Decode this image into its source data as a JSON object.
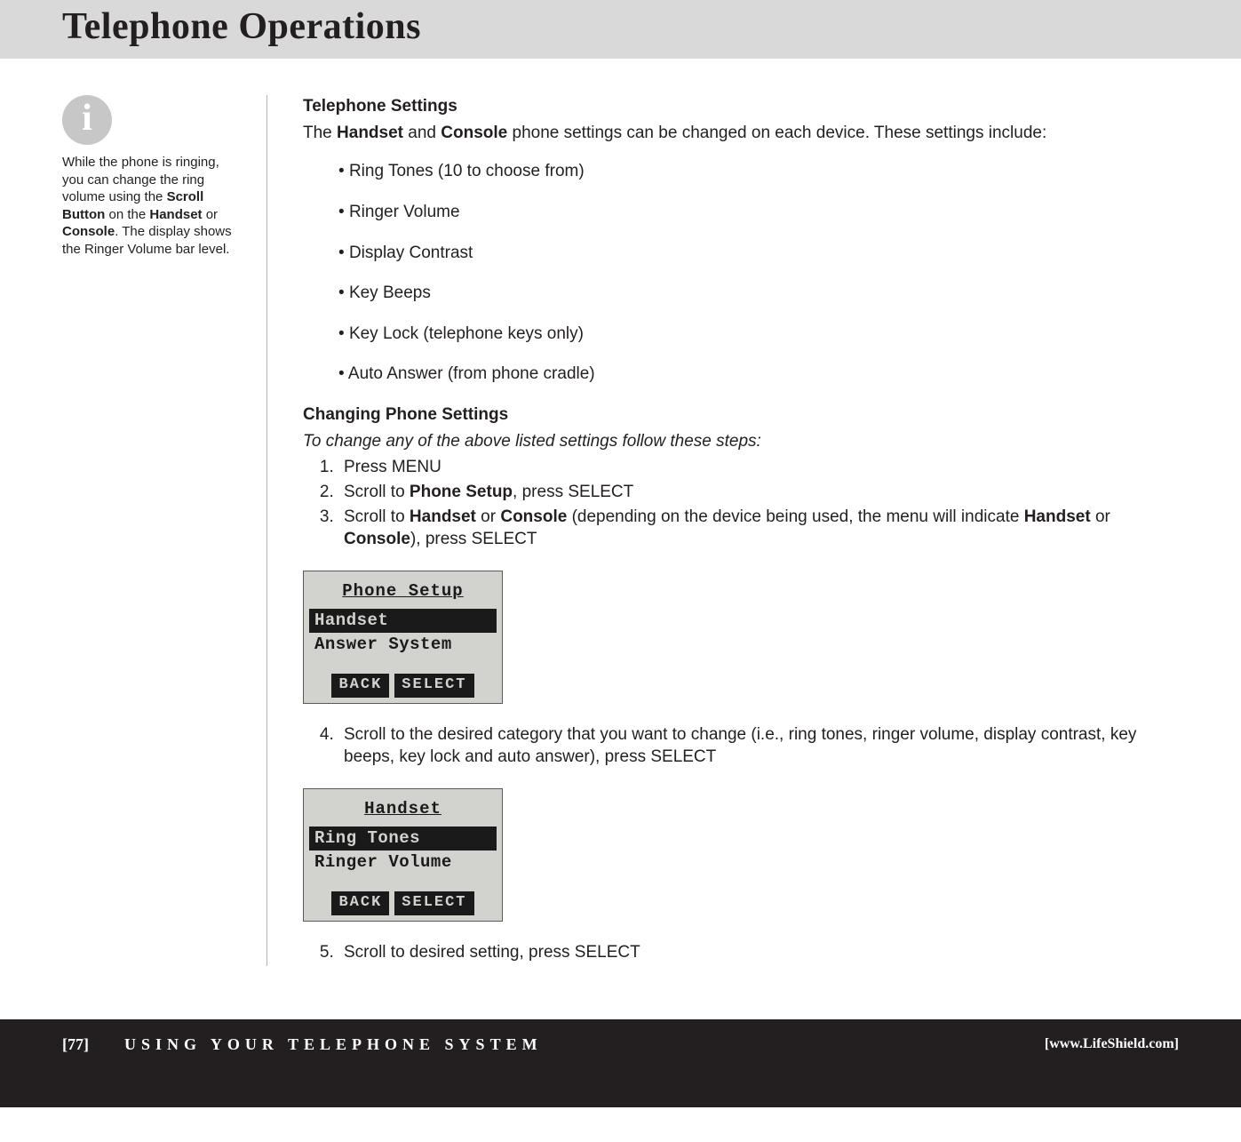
{
  "header": {
    "title": "Telephone Operations"
  },
  "sidebar": {
    "tip_parts": [
      "While the phone is ringing, you can change the ring volume using the ",
      "Scroll Button",
      " on the ",
      "Handset",
      " or ",
      "Console",
      ". The display shows the Ringer Volume bar level."
    ]
  },
  "main": {
    "settings_title": "Telephone Settings",
    "settings_intro_parts": [
      "The ",
      "Handset",
      " and ",
      "Console",
      " phone settings can be changed on each device. These settings include:"
    ],
    "bullets": [
      "Ring Tones (10 to choose from)",
      "Ringer Volume",
      "Display Contrast",
      "Key Beeps",
      "Key Lock (telephone keys only)",
      "Auto Answer (from phone cradle)"
    ],
    "changing_title": "Changing Phone Settings",
    "changing_lead": "To change any of the above listed settings follow these steps:",
    "steps_1_3": [
      {
        "plain": "Press MENU"
      },
      {
        "parts": [
          "Scroll to ",
          "Phone Setup",
          ", press SELECT"
        ]
      },
      {
        "parts": [
          "Scroll to ",
          "Handset",
          " or ",
          "Console",
          " (depending on the device being used, the menu will indicate ",
          "Handset",
          " or ",
          "Console",
          "), press SELECT"
        ]
      }
    ],
    "lcd1": {
      "title": "Phone Setup",
      "rows": [
        {
          "text": "Handset",
          "selected": true
        },
        {
          "text": "Answer System",
          "selected": false
        }
      ],
      "buttons": [
        "BACK",
        "SELECT"
      ]
    },
    "step4": "Scroll to the desired category that you want to change (i.e., ring tones, ringer volume, display contrast, key beeps, key lock and auto answer), press SELECT",
    "lcd2": {
      "title": "Handset",
      "rows": [
        {
          "text": "Ring Tones",
          "selected": true
        },
        {
          "text": "Ringer Volume",
          "selected": false
        }
      ],
      "buttons": [
        "BACK",
        "SELECT"
      ]
    },
    "step5": "Scroll to desired setting, press SELECT"
  },
  "footer": {
    "page": "[77]",
    "title": "USING YOUR TELEPHONE SYSTEM",
    "url": "[www.LifeShield.com]"
  }
}
